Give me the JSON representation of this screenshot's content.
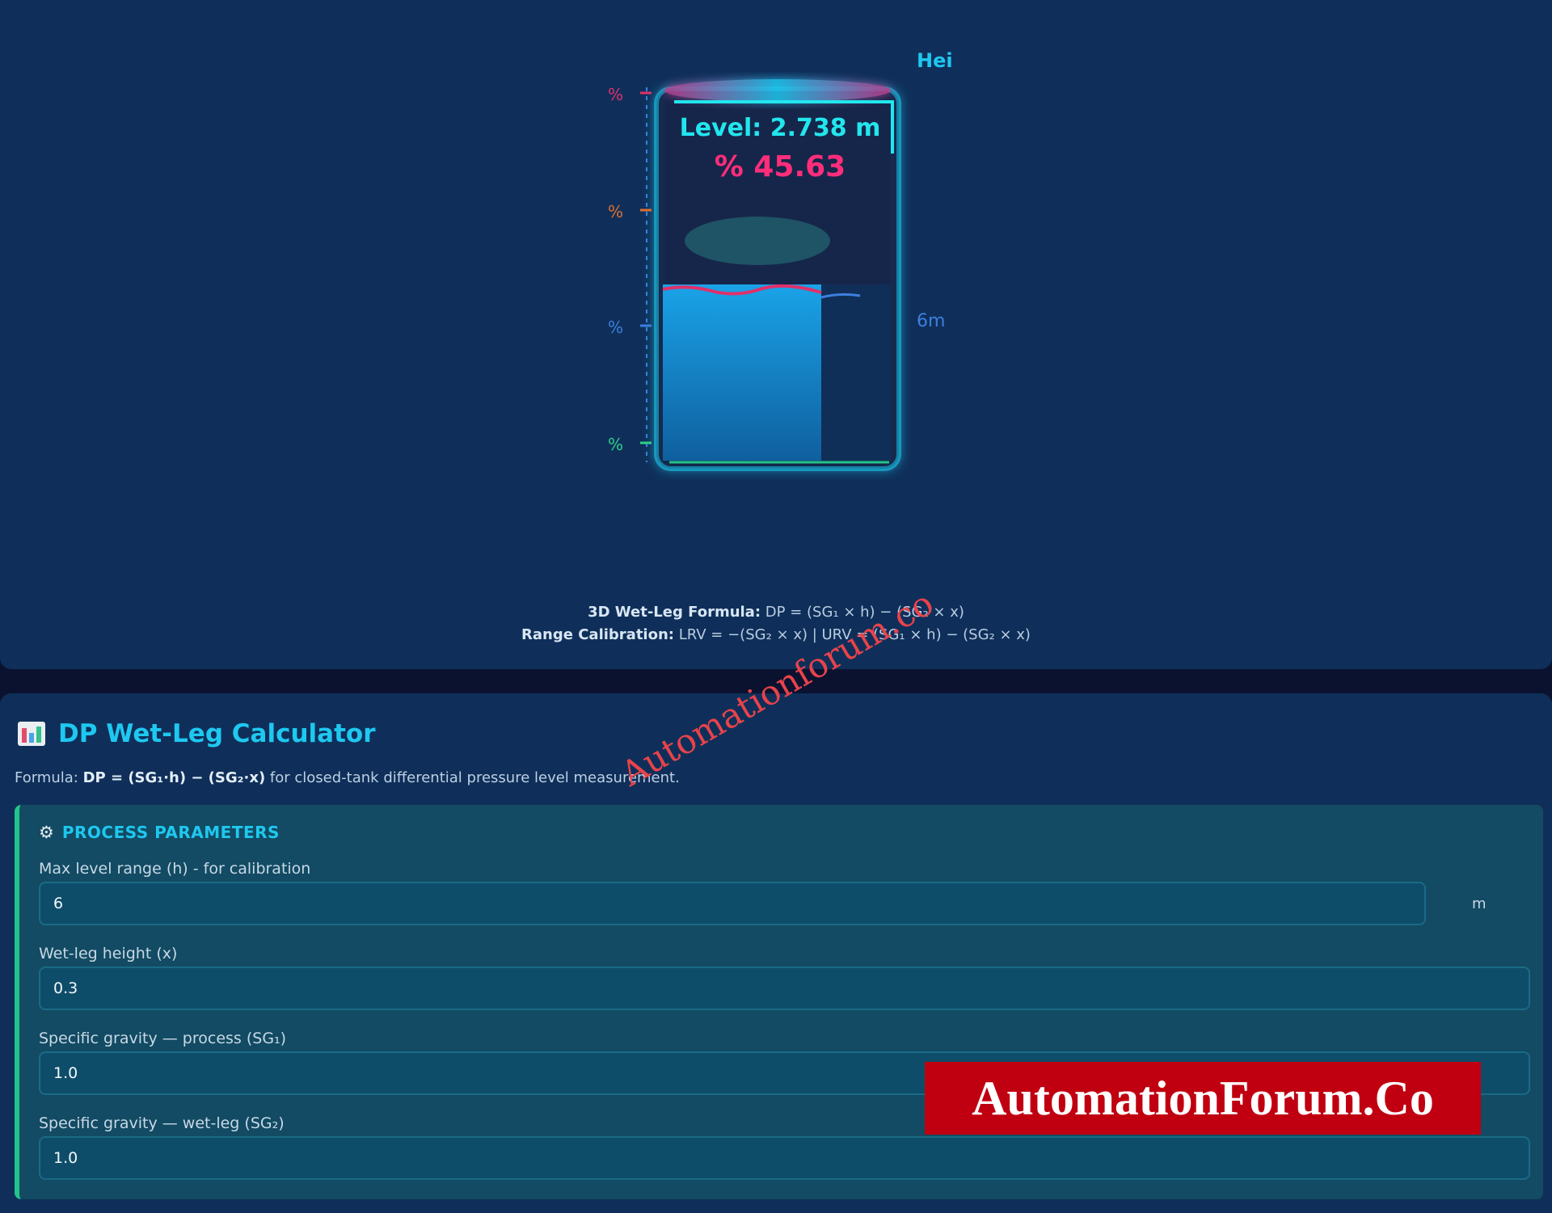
{
  "tank": {
    "title_clip": "Hei",
    "level_text": "Level: 2.738 m",
    "percent_text": "% 45.63",
    "range_label": "6m",
    "level_fraction": 0.4563,
    "scale_marks": [
      {
        "label": "%",
        "color": "#e0306a"
      },
      {
        "label": "%",
        "color": "#e07030"
      },
      {
        "label": "%",
        "color": "#3d7fe0"
      },
      {
        "label": "%",
        "color": "#2fd08a"
      }
    ],
    "colors": {
      "level_text": "#22e6ee",
      "percent_text": "#ff2d7a",
      "liquid": "#1aa3e8",
      "tank_glow": "#1ec8f0"
    }
  },
  "formula": {
    "line1_label": "3D Wet-Leg Formula:",
    "line1_text": " DP = (SG₁ × h) − (SG₂ × x)",
    "line2_label": "Range Calibration:",
    "line2_text": " LRV = −(SG₂ × x) | URV = (SG₁ × h) − (SG₂ × x)"
  },
  "calculator": {
    "icon": "bar-chart-icon",
    "title": "DP Wet-Leg Calculator",
    "desc_prefix": "Formula: ",
    "desc_formula": "DP = (SG₁·h) − (SG₂·x)",
    "desc_suffix": " for closed-tank differential pressure level measurement.",
    "params_icon": "gear-icon",
    "params_title": "PROCESS PARAMETERS",
    "fields": [
      {
        "label": "Max level range (h) - for calibration",
        "value": "6",
        "unit": "m"
      },
      {
        "label": "Wet-leg height (x)",
        "value": "0.3"
      },
      {
        "label": "Specific gravity — process (SG₁)",
        "value": "1.0"
      },
      {
        "label": "Specific gravity — wet-leg (SG₂)",
        "value": "1.0"
      }
    ]
  },
  "watermarks": {
    "diagonal": "Automationforum.co",
    "badge": "AutomationForum.Co"
  }
}
